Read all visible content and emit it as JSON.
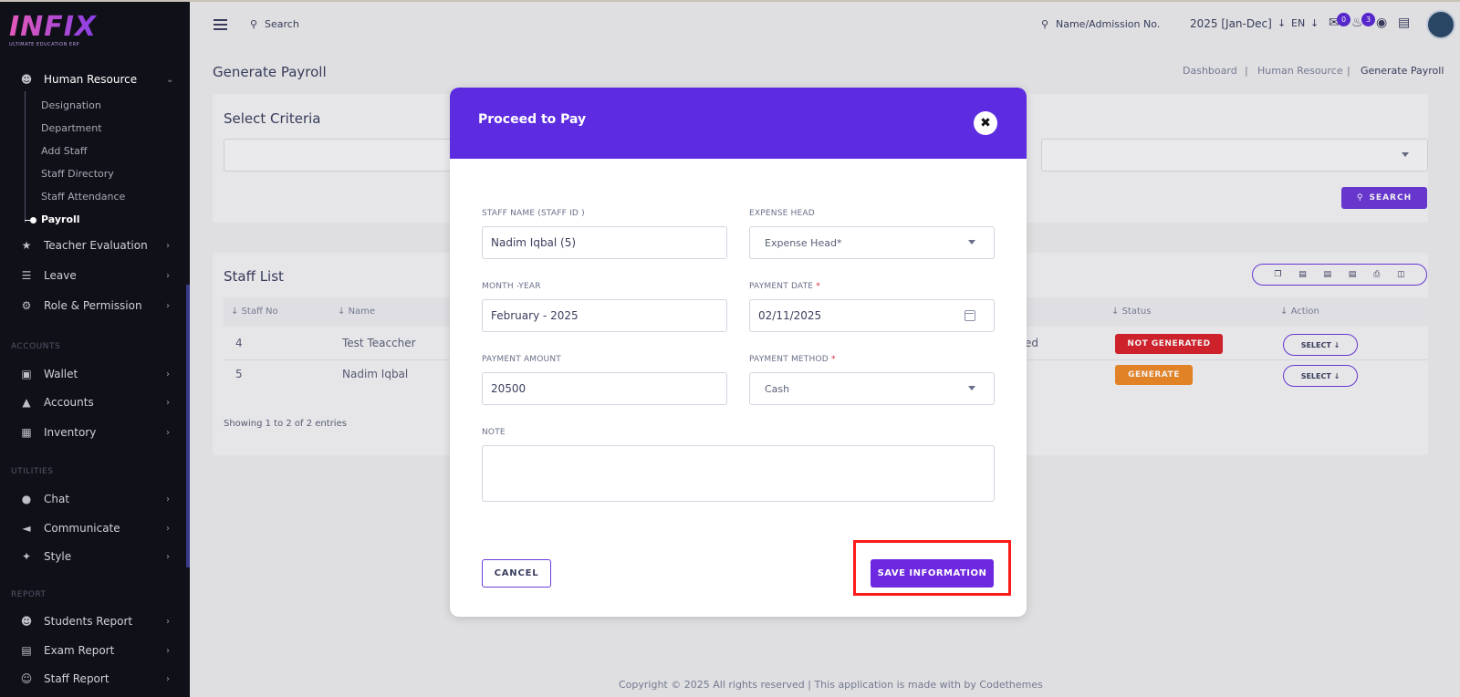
{
  "app": {
    "logo": "INFIX",
    "logo_sub": "ULTIMATE EDUCATION ERP"
  },
  "sidebar": {
    "human_resource": "Human Resource",
    "sub_items": [
      "Designation",
      "Department",
      "Add Staff",
      "Staff Directory",
      "Staff Attendance",
      "Payroll"
    ],
    "items_top": [
      "Teacher Evaluation",
      "Leave",
      "Role & Permission"
    ],
    "section_accounts": "ACCOUNTS",
    "items_accounts": [
      "Wallet",
      "Accounts",
      "Inventory"
    ],
    "section_utilities": "UTILITIES",
    "items_utilities": [
      "Chat",
      "Communicate",
      "Style"
    ],
    "section_report": "REPORT",
    "items_report": [
      "Students Report",
      "Exam Report",
      "Staff Report"
    ]
  },
  "topbar": {
    "search_placeholder": "Search",
    "search2_placeholder": "Name/Admission No.",
    "session": "2025 [Jan-Dec]",
    "lang": "EN",
    "chat_badge": "0",
    "notif_badge": "3"
  },
  "page": {
    "title": "Generate Payroll",
    "breadcrumbs": [
      "Dashboard",
      "Human Resource",
      "Generate Payroll"
    ],
    "select_criteria": "Select Criteria",
    "search_btn": "SEARCH",
    "staff_list": "Staff List",
    "columns": [
      "Staff No",
      "Name",
      "Status",
      "Action"
    ],
    "rows": [
      {
        "no": "4",
        "name": "Test Teaccher",
        "partial": "ed",
        "status": "NOT GENERATED",
        "action": "SELECT"
      },
      {
        "no": "5",
        "name": "Nadim Iqbal",
        "partial": "",
        "status": "GENERATE",
        "action": "SELECT"
      }
    ],
    "showing": "Showing 1 to 2 of 2 entries",
    "footer": "Copyright © 2025 All rights reserved | This application is made with by Codethemes"
  },
  "modal": {
    "title": "Proceed to Pay",
    "staff_label": "STAFF NAME (STAFF ID )",
    "staff_value": "Nadim Iqbal (5)",
    "expense_label": "EXPENSE HEAD",
    "expense_value": "Expense Head*",
    "month_label": "MONTH -YEAR",
    "month_value": "February - 2025",
    "date_label": "PAYMENT DATE",
    "date_value": "02/11/2025",
    "amount_label": "PAYMENT AMOUNT",
    "amount_value": "20500",
    "method_label": "PAYMENT METHOD",
    "method_value": "Cash",
    "note_label": "NOTE",
    "required_mark": "*",
    "cancel": "CANCEL",
    "save": "SAVE INFORMATION"
  },
  "colors": {
    "accent": "#5d2be0",
    "sidebar_bg": "#101018",
    "not_generated": "#d8242f",
    "generate": "#ef8a2a",
    "highlight": "#ff1a1a"
  }
}
